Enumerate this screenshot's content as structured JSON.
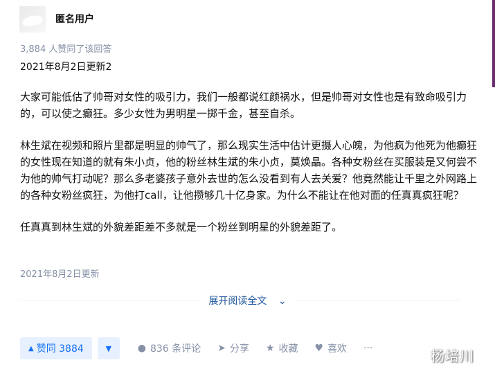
{
  "author": {
    "name": "匿名用户"
  },
  "vote_summary": "3,884 人赞同了该回答",
  "updated_top": "2021年8月2日更新2",
  "paragraphs": [
    "大家可能低估了帅哥对女性的吸引力，我们一般都说红颜祸水，但是帅哥对女性也是有致命吸引力的，可以使之癫狂。多少女性为男明星一掷千金，甚至自杀。",
    "林生斌在视频和照片里都是明显的帅气了，那么现实生活中估计更摄人心魄，为他疯为他死为他癫狂的女性现在知道的就有朱小贞，他的粉丝林生斌的朱小贞，莫焕晶。各种女粉丝在买服装是又何尝不为他的帅气打动呢？那么多老婆孩子意外去世的怎么没看到有人去关爱？他竟然能让千里之外网路上的各种女粉丝疯狂，为他打call，让他攒够几十亿身家。为什么不能让在他对面的任真真疯狂呢？",
    "任真真到林生斌的外貌差距差不多就是一个粉丝到明星的外貌差距了。"
  ],
  "updated_bottom": "2021年8月2日更新",
  "expand_label": "展开阅读全文",
  "actions": {
    "vote_up_label": "赞同 3884",
    "comment_label": "836 条评论",
    "share_label": "分享",
    "collect_label": "收藏",
    "like_label": "喜欢",
    "more_label": "···"
  },
  "watermark": "杨培川",
  "colors": {
    "accent": "#1772f6",
    "accent_bg": "#e7f0fe",
    "muted": "#8590a6",
    "link": "#175199"
  }
}
